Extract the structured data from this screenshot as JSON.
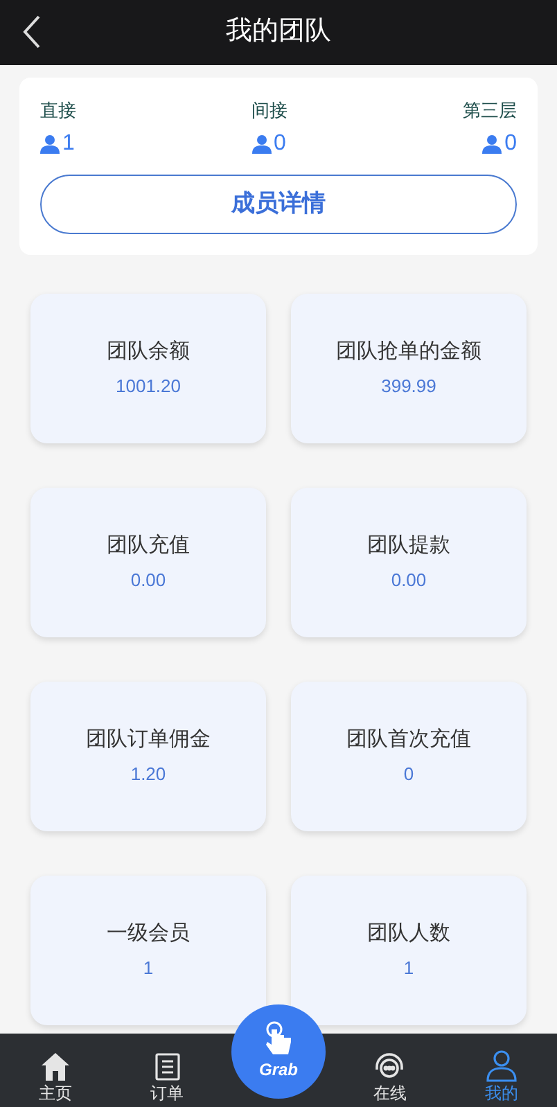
{
  "header": {
    "title": "我的团队"
  },
  "levels": [
    {
      "label": "直接",
      "count": "1"
    },
    {
      "label": "间接",
      "count": "0"
    },
    {
      "label": "第三层",
      "count": "0"
    }
  ],
  "details_button": "成员详情",
  "stats": [
    {
      "label": "团队余额",
      "value": "1001.20"
    },
    {
      "label": "团队抢单的金额",
      "value": "399.99"
    },
    {
      "label": "团队充值",
      "value": "0.00"
    },
    {
      "label": "团队提款",
      "value": "0.00"
    },
    {
      "label": "团队订单佣金",
      "value": "1.20"
    },
    {
      "label": "团队首次充值",
      "value": "0"
    },
    {
      "label": "一级会员",
      "value": "1"
    },
    {
      "label": "团队人数",
      "value": "1"
    }
  ],
  "nav": [
    {
      "kind": "home",
      "label": "主页",
      "selected": false
    },
    {
      "kind": "orders",
      "label": "订单",
      "selected": false
    },
    {
      "kind": "grab",
      "label": "Grab",
      "selected": false
    },
    {
      "kind": "online",
      "label": "在线",
      "selected": false
    },
    {
      "kind": "mine",
      "label": "我的",
      "selected": true
    }
  ]
}
